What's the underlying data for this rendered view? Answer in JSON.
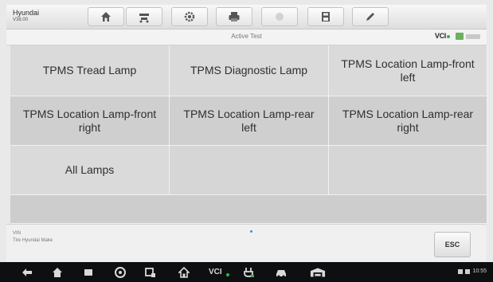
{
  "vehicle": {
    "make": "Hyundai",
    "model": "V38.00"
  },
  "toolbar": {
    "buttons": [
      "home",
      "vehicle-swap",
      "settings",
      "print",
      "help",
      "save",
      "edit"
    ]
  },
  "subbar": {
    "title": "Active Test",
    "vci_label": "VCI"
  },
  "lamps": [
    "TPMS Tread Lamp",
    "TPMS Diagnostic Lamp",
    "TPMS Location Lamp-front left",
    "TPMS Location Lamp-front right",
    "TPMS Location Lamp-rear left",
    "TPMS Location Lamp-rear right",
    "All Lamps"
  ],
  "footer": {
    "vin_label": "VIN",
    "vin_value": "Tire Hyundai Make",
    "esc_label": "ESC"
  },
  "navbar": {
    "vci_label": "VCI",
    "status_time": "10:55"
  },
  "colors": {
    "vci_green": "#32b34a",
    "page_dot": "#3a8fd6"
  }
}
